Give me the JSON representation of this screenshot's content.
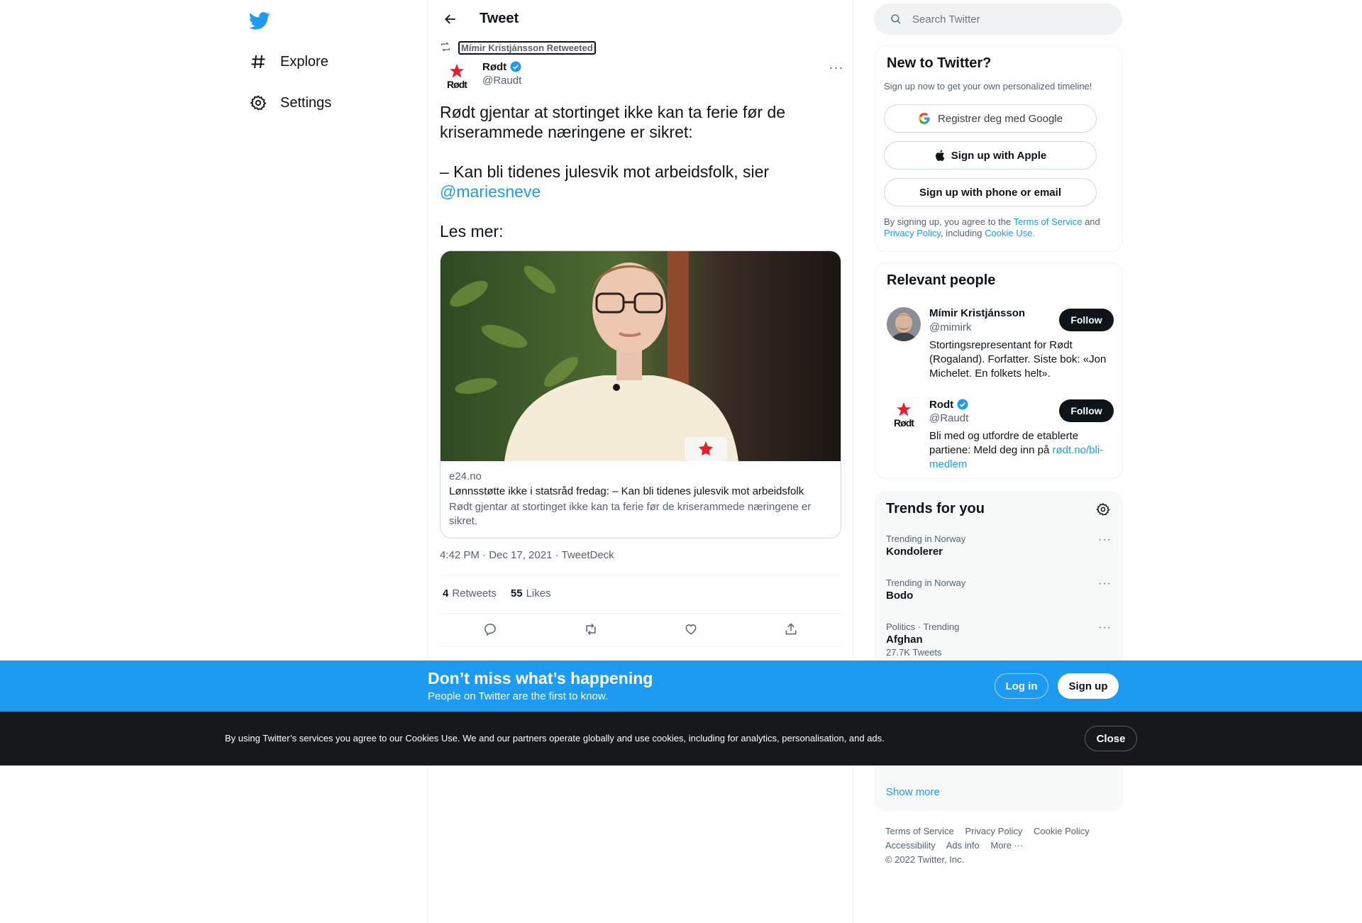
{
  "nav": {
    "items": [
      {
        "label": "Explore",
        "icon": "hashtag-icon"
      },
      {
        "label": "Settings",
        "icon": "gear-icon"
      }
    ]
  },
  "header": {
    "title": "Tweet"
  },
  "tweet": {
    "retweeted_by": "Mímir Kristjánsson Retweeted",
    "author_name": "Rødt",
    "author_handle": "@Raudt",
    "avatar_text": "Rødt",
    "text_line1": "Rødt gjentar at stortinget ikke kan ta ferie før de kriserammede næringene er sikret:",
    "text_line2": "– Kan bli tidenes julesvik mot arbeidsfolk, sier",
    "mention": "@mariesneve",
    "text_line3": "Les mer:",
    "card": {
      "domain": "e24.no",
      "title": "Lønnsstøtte ikke i statsråd fredag: – Kan bli tidenes julesvik mot arbeidsfolk",
      "description": "Rødt gjentar at stortinget ikke kan ta ferie før de kriserammede næringene er sikret."
    },
    "timestamp": "4:42 PM · Dec 17, 2021 · TweetDeck",
    "retweets_count": "4",
    "retweets_label": "Retweets",
    "likes_count": "55",
    "likes_label": "Likes"
  },
  "search": {
    "placeholder": "Search Twitter"
  },
  "new_to_twitter": {
    "title": "New to Twitter?",
    "subtitle": "Sign up now to get your own personalized timeline!",
    "google_label": "Registrer deg med Google",
    "apple_label": "Sign up with Apple",
    "phone_label": "Sign up with phone or email",
    "terms_prefix": "By signing up, you agree to the",
    "terms_link": "Terms of Service",
    "terms_and": "and",
    "privacy_link": "Privacy Policy",
    "terms_including": ", including",
    "cookie_link": "Cookie Use."
  },
  "relevant_people": {
    "title": "Relevant people",
    "people": [
      {
        "name": "Mímir Kristjánsson",
        "handle": "@mimirk",
        "bio": "Stortingsrepresentant for Rødt (Rogaland). Forfatter. Siste bok: «Jon Michelet. En folkets helt».",
        "follow": "Follow"
      },
      {
        "name": "Rodt",
        "handle": "@Raudt",
        "bio": "Bli med og utfordre de etablerte partiene: Meld deg inn på",
        "bio_link": "rødt.no/bli-medlem",
        "follow": "Follow",
        "avatar_text": "Rødt"
      }
    ]
  },
  "trends": {
    "title": "Trends for you",
    "items": [
      {
        "context": "Trending in Norway",
        "name": "Kondolerer"
      },
      {
        "context": "Trending in Norway",
        "name": "Bodo"
      },
      {
        "context": "Politics · Trending",
        "name": "Afghan",
        "count": "27.7K Tweets"
      }
    ],
    "show_more": "Show more"
  },
  "footer": {
    "links": [
      "Terms of Service",
      "Privacy Policy",
      "Cookie Policy",
      "Accessibility",
      "Ads info",
      "More ···"
    ],
    "copyright": "© 2022 Twitter, Inc."
  },
  "login_bar": {
    "title": "Don’t miss what’s happening",
    "subtitle": "People on Twitter are the first to know.",
    "login": "Log in",
    "signup": "Sign up"
  },
  "cookie_bar": {
    "text": "By using Twitter’s services you agree to our Cookies Use. We and our partners operate globally and use cookies, including for analytics, personalisation, and ads.",
    "close": "Close"
  },
  "colors": {
    "accent": "#1d9bf0",
    "banner": "#1d9bf0",
    "cookie_bg": "#16181c",
    "rodt_red": "#e4202c"
  }
}
